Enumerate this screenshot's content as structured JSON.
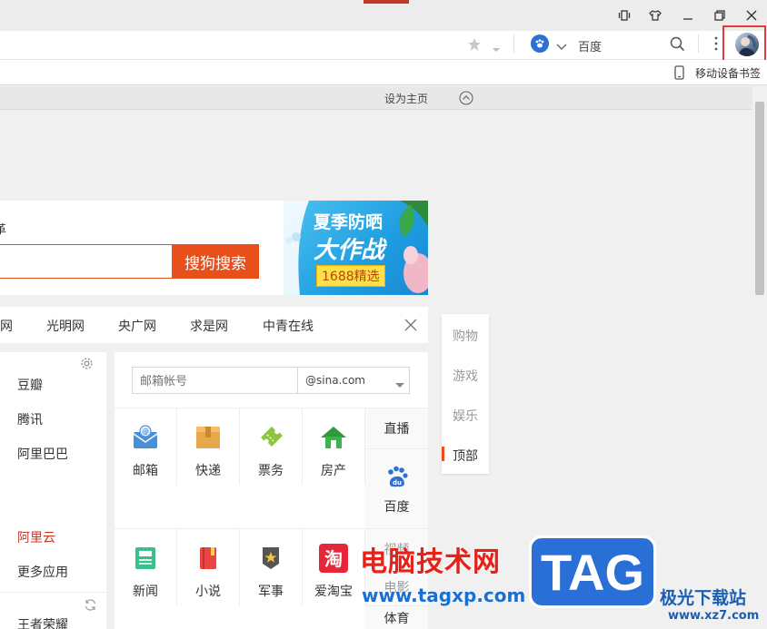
{
  "addressbar": {
    "search_engine": "百度"
  },
  "bookmarkbar": {
    "mobile_bookmarks": "移动设备书签"
  },
  "homebar": {
    "set_home": "设为主页"
  },
  "search": {
    "label_fragment": "革",
    "button": "搜狗搜索"
  },
  "ad": {
    "line1": "夏季防晒",
    "line2": "大作战",
    "badge": "1688精选"
  },
  "links": [
    "网",
    "光明网",
    "央广网",
    "求是网",
    "中青在线"
  ],
  "left_column": {
    "items": [
      "豆瓣",
      "腾讯",
      "阿里巴巴",
      "阿里云",
      "更多应用",
      "王者荣耀"
    ]
  },
  "mail": {
    "placeholder": "邮箱帐号",
    "domain": "@sina.com"
  },
  "services_row1": [
    "邮箱",
    "快递",
    "票务",
    "房产"
  ],
  "services_row2": [
    "新闻",
    "小说",
    "军事",
    "爱淘宝"
  ],
  "right_services": [
    "直播",
    "百度",
    "视频",
    "电影",
    "体育"
  ],
  "float_nav": [
    "购物",
    "游戏",
    "娱乐",
    "顶部"
  ],
  "watermark": {
    "text": "电脑技术网",
    "url": "www.tagxp.com",
    "tag": "TAG",
    "site": "极光下载站",
    "site_url": "www.xz7.com"
  },
  "colors": {
    "accent": "#e8501b",
    "highlight": "#e53935",
    "baidu_blue": "#2e6fd6"
  }
}
